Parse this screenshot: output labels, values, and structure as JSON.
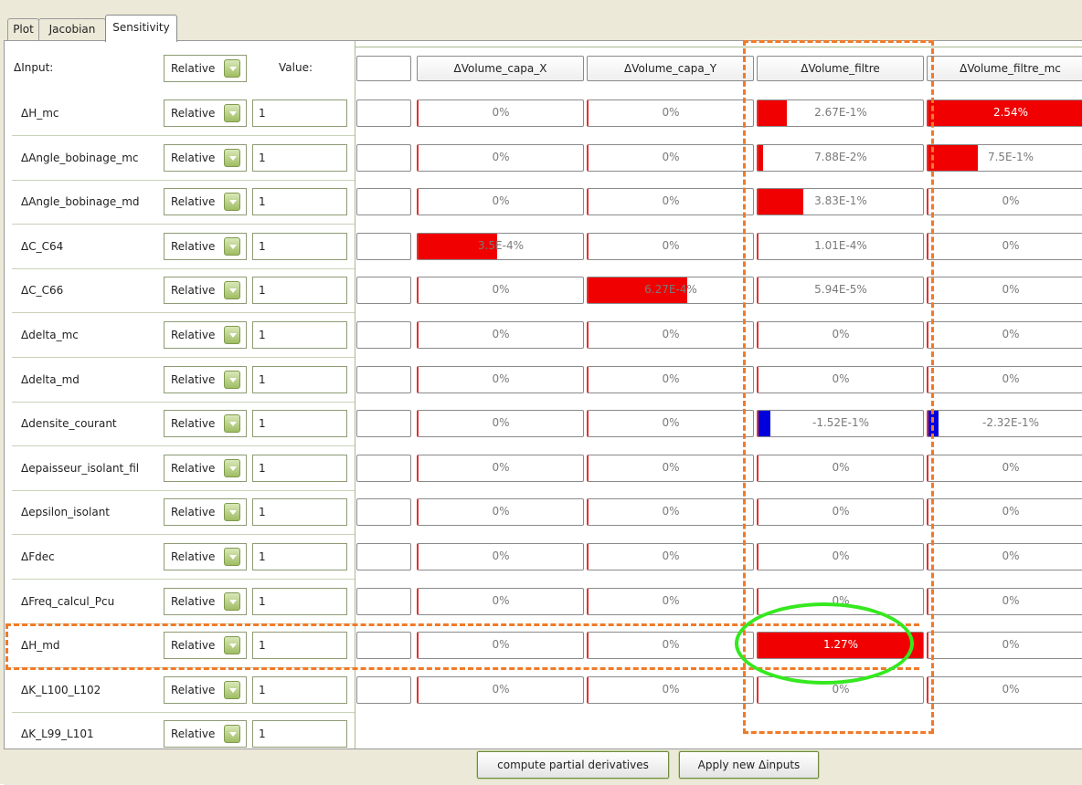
{
  "tabs": [
    "Plot",
    "Jacobian",
    "Sensitivity"
  ],
  "header": {
    "input_label": "ΔInput:",
    "mode": "Relative",
    "value_label": "Value:"
  },
  "columns": [
    "ΔVolume_capa_X",
    "ΔVolume_capa_Y",
    "ΔVolume_filtre",
    "ΔVolume_filtre_mc"
  ],
  "rows": [
    {
      "name": "ΔH_mc",
      "mode": "Relative",
      "value": "1",
      "cells": [
        {
          "text": "0%",
          "fill": 0,
          "color": "red"
        },
        {
          "text": "0%",
          "fill": 0,
          "color": "red"
        },
        {
          "text": "2.67E-1%",
          "fill": 0.17,
          "color": "red"
        },
        {
          "text": "2.54%",
          "fill": 1.0,
          "color": "red"
        }
      ]
    },
    {
      "name": "ΔAngle_bobinage_mc",
      "mode": "Relative",
      "value": "1",
      "cells": [
        {
          "text": "0%",
          "fill": 0,
          "color": "red"
        },
        {
          "text": "0%",
          "fill": 0,
          "color": "red"
        },
        {
          "text": "7.88E-2%",
          "fill": 0.03,
          "color": "red"
        },
        {
          "text": "7.5E-1%",
          "fill": 0.3,
          "color": "red"
        }
      ]
    },
    {
      "name": "ΔAngle_bobinage_md",
      "mode": "Relative",
      "value": "1",
      "cells": [
        {
          "text": "0%",
          "fill": 0,
          "color": "red"
        },
        {
          "text": "0%",
          "fill": 0,
          "color": "red"
        },
        {
          "text": "3.83E-1%",
          "fill": 0.27,
          "color": "red"
        },
        {
          "text": "0%",
          "fill": 0,
          "color": "red"
        }
      ]
    },
    {
      "name": "ΔC_C64",
      "mode": "Relative",
      "value": "1",
      "cells": [
        {
          "text": "3.5E-4%",
          "fill": 0.48,
          "color": "red"
        },
        {
          "text": "0%",
          "fill": 0,
          "color": "red"
        },
        {
          "text": "1.01E-4%",
          "fill": 0,
          "color": "red"
        },
        {
          "text": "0%",
          "fill": 0,
          "color": "red"
        }
      ]
    },
    {
      "name": "ΔC_C66",
      "mode": "Relative",
      "value": "1",
      "cells": [
        {
          "text": "0%",
          "fill": 0,
          "color": "red"
        },
        {
          "text": "6.27E-4%",
          "fill": 0.6,
          "color": "red"
        },
        {
          "text": "5.94E-5%",
          "fill": 0,
          "color": "red"
        },
        {
          "text": "0%",
          "fill": 0,
          "color": "red"
        }
      ]
    },
    {
      "name": "Δdelta_mc",
      "mode": "Relative",
      "value": "1",
      "cells": [
        {
          "text": "0%",
          "fill": 0,
          "color": "red"
        },
        {
          "text": "0%",
          "fill": 0,
          "color": "red"
        },
        {
          "text": "0%",
          "fill": 0,
          "color": "red"
        },
        {
          "text": "0%",
          "fill": 0,
          "color": "red"
        }
      ]
    },
    {
      "name": "Δdelta_md",
      "mode": "Relative",
      "value": "1",
      "cells": [
        {
          "text": "0%",
          "fill": 0,
          "color": "red"
        },
        {
          "text": "0%",
          "fill": 0,
          "color": "red"
        },
        {
          "text": "0%",
          "fill": 0,
          "color": "red"
        },
        {
          "text": "0%",
          "fill": 0,
          "color": "red"
        }
      ]
    },
    {
      "name": "Δdensite_courant",
      "mode": "Relative",
      "value": "1",
      "cells": [
        {
          "text": "0%",
          "fill": 0,
          "color": "red"
        },
        {
          "text": "0%",
          "fill": 0,
          "color": "red"
        },
        {
          "text": "-1.52E-1%",
          "fill": 0.07,
          "color": "blue"
        },
        {
          "text": "-2.32E-1%",
          "fill": 0.06,
          "color": "blue"
        }
      ]
    },
    {
      "name": "Δepaisseur_isolant_fil",
      "mode": "Relative",
      "value": "1",
      "cells": [
        {
          "text": "0%",
          "fill": 0,
          "color": "red"
        },
        {
          "text": "0%",
          "fill": 0,
          "color": "red"
        },
        {
          "text": "0%",
          "fill": 0,
          "color": "red"
        },
        {
          "text": "0%",
          "fill": 0,
          "color": "red"
        }
      ]
    },
    {
      "name": "Δepsilon_isolant",
      "mode": "Relative",
      "value": "1",
      "cells": [
        {
          "text": "0%",
          "fill": 0,
          "color": "red"
        },
        {
          "text": "0%",
          "fill": 0,
          "color": "red"
        },
        {
          "text": "0%",
          "fill": 0,
          "color": "red"
        },
        {
          "text": "0%",
          "fill": 0,
          "color": "red"
        }
      ]
    },
    {
      "name": "ΔFdec",
      "mode": "Relative",
      "value": "1",
      "cells": [
        {
          "text": "0%",
          "fill": 0,
          "color": "red"
        },
        {
          "text": "0%",
          "fill": 0,
          "color": "red"
        },
        {
          "text": "0%",
          "fill": 0,
          "color": "red"
        },
        {
          "text": "0%",
          "fill": 0,
          "color": "red"
        }
      ]
    },
    {
      "name": "ΔFreq_calcul_Pcu",
      "mode": "Relative",
      "value": "1",
      "cells": [
        {
          "text": "0%",
          "fill": 0,
          "color": "red"
        },
        {
          "text": "0%",
          "fill": 0,
          "color": "red"
        },
        {
          "text": "0%",
          "fill": 0,
          "color": "red"
        },
        {
          "text": "0%",
          "fill": 0,
          "color": "red"
        }
      ]
    },
    {
      "name": "ΔH_md",
      "mode": "Relative",
      "value": "1",
      "cells": [
        {
          "text": "0%",
          "fill": 0,
          "color": "red"
        },
        {
          "text": "0%",
          "fill": 0,
          "color": "red"
        },
        {
          "text": "1.27%",
          "fill": 1.0,
          "color": "red"
        },
        {
          "text": "0%",
          "fill": 0,
          "color": "red"
        }
      ]
    },
    {
      "name": "ΔK_L100_L102",
      "mode": "Relative",
      "value": "1",
      "cells": [
        {
          "text": "0%",
          "fill": 0,
          "color": "red"
        },
        {
          "text": "0%",
          "fill": 0,
          "color": "red"
        },
        {
          "text": "0%",
          "fill": 0,
          "color": "red"
        },
        {
          "text": "0%",
          "fill": 0,
          "color": "red"
        }
      ]
    },
    {
      "name": "ΔK_L99_L101",
      "mode": "Relative",
      "value": "1",
      "cells": []
    }
  ],
  "buttons": {
    "compute": "compute partial derivatives",
    "apply": "Apply new Δinputs"
  },
  "colors": {
    "positive": "#f00000",
    "negative": "#0000dd",
    "annotation_dash": "#f07a28",
    "annotation_circle": "#35e81f"
  }
}
